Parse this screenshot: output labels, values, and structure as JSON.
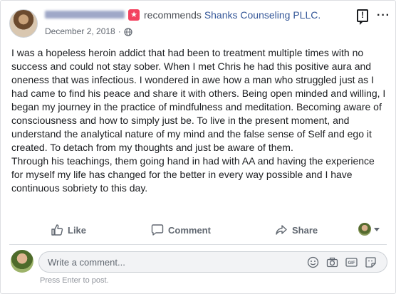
{
  "post": {
    "recommends_verb": "recommends",
    "page_name": "Shanks Counseling PLLC.",
    "date": "December 2, 2018",
    "meta_separator": "·",
    "badge_symbol": "★",
    "paragraphs": [
      "I was a hopeless heroin addict that had been to treatment multiple times with no success and could not stay sober. When I met Chris he had this positive aura and oneness that was infectious. I wondered in awe how a man who struggled just as I had came to find his peace and share it with others. Being open minded and willing, I began my journey in the practice of mindfulness and meditation. Becoming aware of consciousness and how to simply just be. To live in the present moment, and understand the analytical nature of my mind and the false sense of Self and ego it created. To detach from my thoughts and just be aware of them.",
      "Through his teachings, them going hand in had with AA and having the experience for myself my life has changed for the better in every way possible and I have continuous sobriety to this day."
    ]
  },
  "actions": {
    "like": "Like",
    "comment": "Comment",
    "share": "Share"
  },
  "composer": {
    "placeholder": "Write a comment...",
    "hint": "Press Enter to post.",
    "gif_label": "GIF"
  },
  "icons": {
    "alert": "alert-bubble-icon",
    "more": "more-options-icon",
    "globe": "globe-icon",
    "like": "thumbs-up-icon",
    "comment": "comment-bubble-icon",
    "share": "share-arrow-icon",
    "emoji": "emoji-icon",
    "camera": "camera-icon",
    "gif": "gif-icon",
    "sticker": "sticker-icon"
  },
  "colors": {
    "link": "#365899",
    "badge": "#f3425f",
    "muted": "#606770"
  }
}
